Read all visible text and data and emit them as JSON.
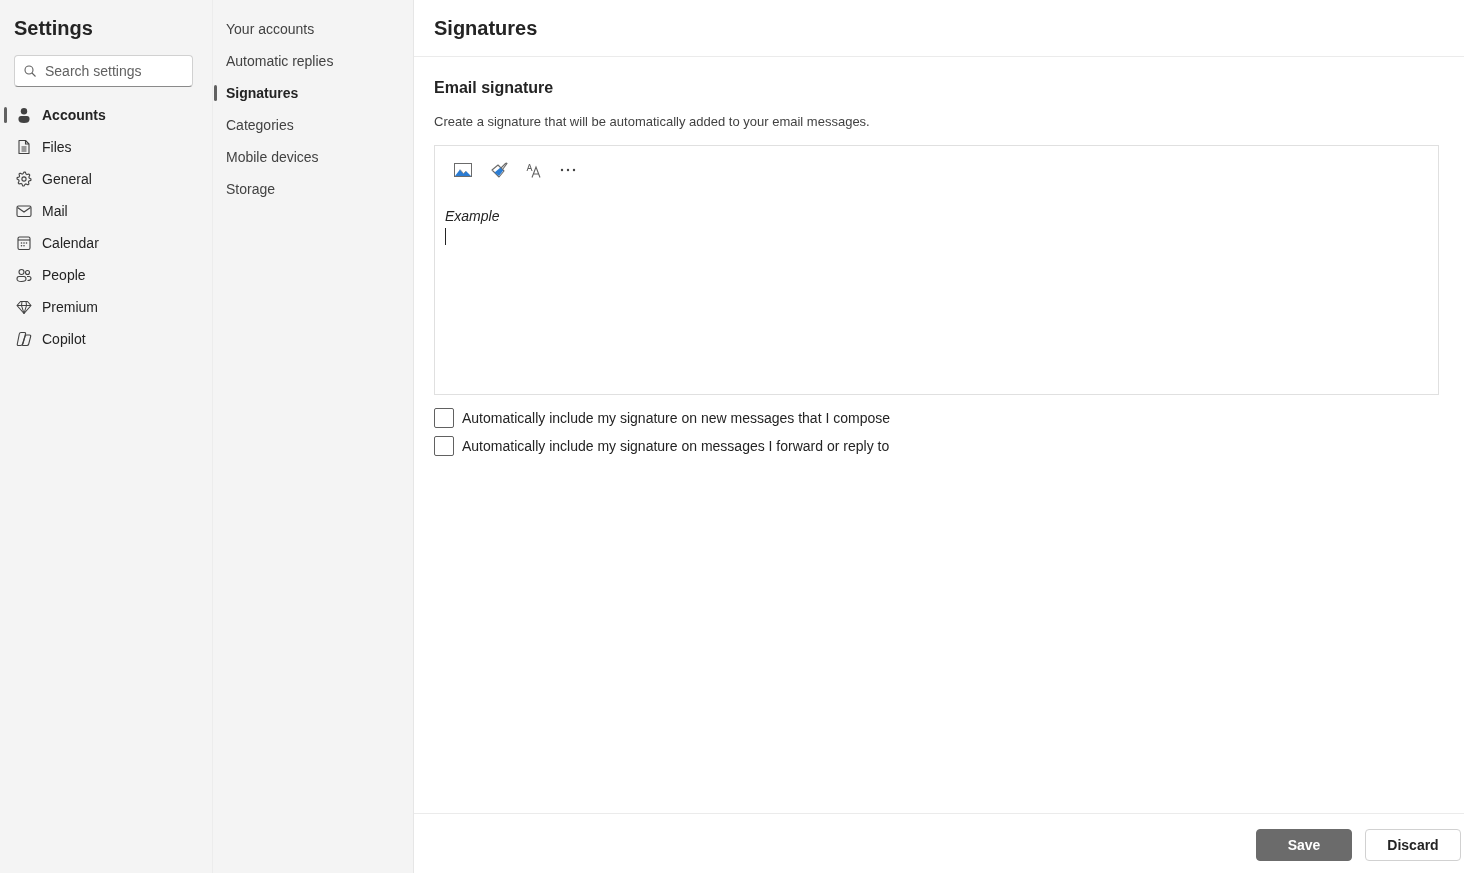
{
  "sidebar": {
    "title": "Settings",
    "search": {
      "placeholder": "Search settings"
    },
    "items": [
      {
        "label": "Accounts",
        "selected": true
      },
      {
        "label": "Files",
        "selected": false
      },
      {
        "label": "General",
        "selected": false
      },
      {
        "label": "Mail",
        "selected": false
      },
      {
        "label": "Calendar",
        "selected": false
      },
      {
        "label": "People",
        "selected": false
      },
      {
        "label": "Premium",
        "selected": false
      },
      {
        "label": "Copilot",
        "selected": false
      }
    ]
  },
  "subnav": {
    "items": [
      {
        "label": "Your accounts",
        "selected": false
      },
      {
        "label": "Automatic replies",
        "selected": false
      },
      {
        "label": "Signatures",
        "selected": true
      },
      {
        "label": "Categories",
        "selected": false
      },
      {
        "label": "Mobile devices",
        "selected": false
      },
      {
        "label": "Storage",
        "selected": false
      }
    ]
  },
  "main": {
    "title": "Signatures",
    "section": {
      "heading": "Email signature",
      "description": "Create a signature that will be automatically added to your email messages.",
      "editor": {
        "content": "Example"
      },
      "options": [
        {
          "label": "Automatically include my signature on new messages that I compose",
          "checked": false
        },
        {
          "label": "Automatically include my signature on messages I forward or reply to",
          "checked": false
        }
      ]
    },
    "buttons": [
      {
        "label": "Save",
        "kind": "primary"
      },
      {
        "label": "Discard",
        "kind": "secondary"
      }
    ]
  }
}
